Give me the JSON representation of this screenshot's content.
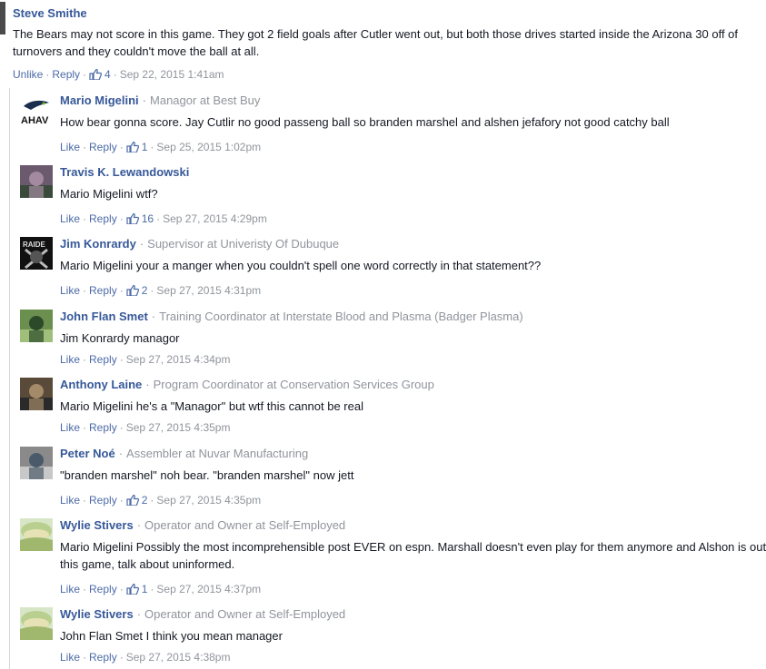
{
  "root": {
    "name": "Steve Smithe",
    "body": "The Bears may not score in this game. They got 2 field goals after Cutler went out, but both those drives started inside the Arizona 30 off of turnovers and they couldn't move the ball at all.",
    "actions": {
      "first": "Unlike",
      "reply": "Reply",
      "likes": "4",
      "time": "Sep 22, 2015 1:41am"
    }
  },
  "labels": {
    "like": "Like",
    "reply": "Reply",
    "sep": "·"
  },
  "replies": [
    {
      "name": "Mario Migelini",
      "work": "Managor at Best Buy",
      "text": "How bear gonna score. Jay Cutlir no good passeng ball so branden marshel and alshen jefafory not good catchy ball",
      "likes": "1",
      "time": "Sep 25, 2015 1:02pm",
      "avatar": "seahawks-logo",
      "avatar_text": "AHAV"
    },
    {
      "name": "Travis K. Lewandowski",
      "work": "",
      "text": "Mario Migelini wtf?",
      "likes": "16",
      "time": "Sep 27, 2015 4:29pm",
      "avatar": "photo"
    },
    {
      "name": "Jim Konrardy",
      "work": "Supervisor at Univeristy Of Dubuque",
      "text": "Mario Migelini your a manger when you couldn't spell one word correctly in that statement??",
      "likes": "2",
      "time": "Sep 27, 2015 4:31pm",
      "avatar": "raiders-logo",
      "avatar_text": "RAIDE"
    },
    {
      "name": "John Flan Smet",
      "work": "Training Coordinator at Interstate Blood and Plasma (Badger Plasma)",
      "text": "Jim Konrardy managor",
      "likes": "",
      "time": "Sep 27, 2015 4:34pm",
      "avatar": "photo"
    },
    {
      "name": "Anthony Laine",
      "work": "Program Coordinator at Conservation Services Group",
      "text": "Mario Migelini he's a \"Managor\" but wtf this cannot be real",
      "likes": "",
      "time": "Sep 27, 2015 4:35pm",
      "avatar": "photo"
    },
    {
      "name": "Peter Noé",
      "work": "Assembler at Nuvar Manufacturing",
      "text": "\"branden marshel\" noh bear. \"branden marshel\" now jett",
      "likes": "2",
      "time": "Sep 27, 2015 4:35pm",
      "avatar": "photo"
    },
    {
      "name": "Wylie Stivers",
      "work": "Operator and Owner at Self-Employed",
      "text": "Mario Migelini Possibly the most incomprehensible post EVER on espn. Marshall doesn't even play for them anymore and Alshon is out this game, talk about uninformed.",
      "likes": "1",
      "time": "Sep 27, 2015 4:37pm",
      "avatar": "landscape"
    },
    {
      "name": "Wylie Stivers",
      "work": "Operator and Owner at Self-Employed",
      "text": "John Flan Smet I think you mean manager",
      "likes": "",
      "time": "Sep 27, 2015 4:38pm",
      "avatar": "landscape"
    }
  ]
}
